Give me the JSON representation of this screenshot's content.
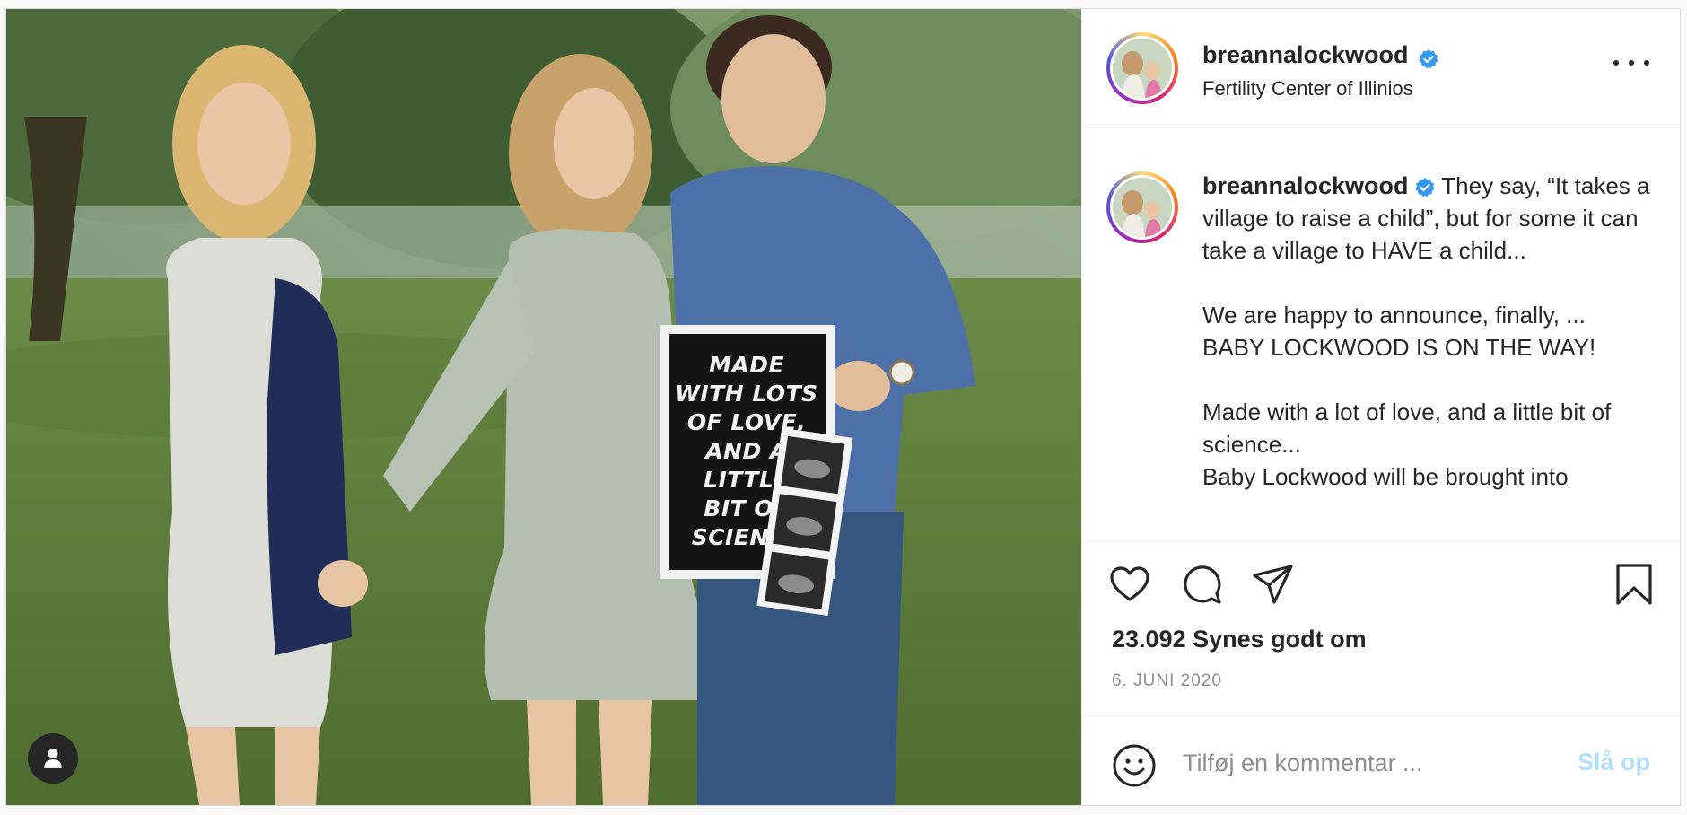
{
  "post": {
    "author": {
      "username": "breannalockwood",
      "verified": true,
      "location": "Fertility Center of Illinios"
    },
    "image": {
      "letterboard_lines": [
        "MADE",
        "WITH LOTS",
        "OF LOVE,",
        "AND A",
        "LITTLE",
        "BIT OF",
        "SCIENCE"
      ],
      "tag_icon": "user-tag-icon"
    },
    "caption": {
      "username": "breannalockwood",
      "text_first_line": " They say, “It takes a village to raise a child”, but for some it can take a village to HAVE a child...",
      "paragraph_2": "We are happy to announce, finally, ...\nBABY LOCKWOOD IS ON THE WAY!",
      "paragraph_3": "Made with a lot of love, and a little bit of science...\nBaby Lockwood will be brought into"
    },
    "likes_text": "23.092 Synes godt om",
    "date_text": "6. JUNI 2020",
    "comment": {
      "placeholder": "Tilføj en kommentar ...",
      "post_label": "Slå op"
    },
    "colors": {
      "verified_blue": "#3897f0",
      "post_button_disabled": "#b2dffc",
      "secondary_text": "#8e8e8e"
    }
  }
}
